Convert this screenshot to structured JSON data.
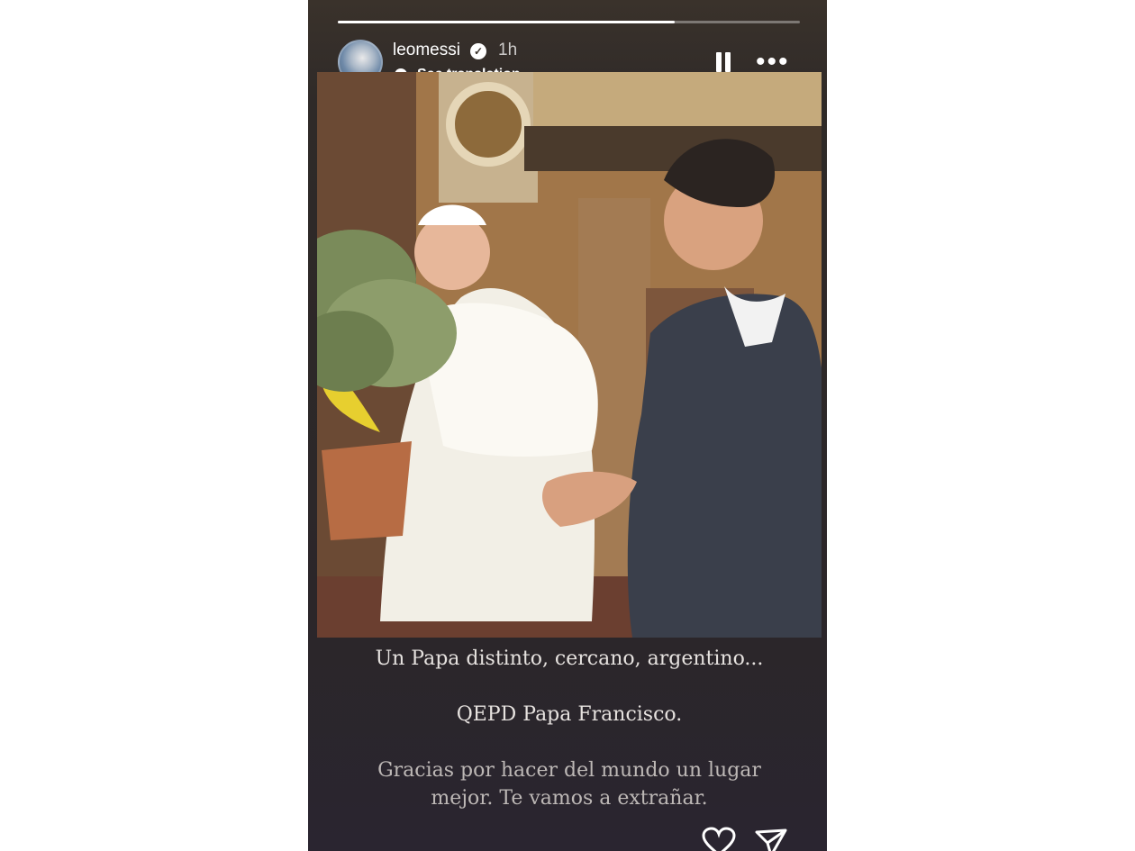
{
  "story": {
    "username": "leomessi",
    "time_ago": "1h",
    "see_translation": "See translation",
    "progress": 0.73,
    "caption_lines": [
      "Un Papa distinto, cercano, argentino...",
      "QEPD Papa Francisco.",
      "Gracias por hacer del mundo un lugar mejor. Te vamos a extrañar."
    ]
  },
  "icons": {
    "verified": "verified-badge-icon",
    "translate": "speech-bubble-icon",
    "pause": "pause-icon",
    "more": "more-dots-icon",
    "like": "heart-icon",
    "share": "send-icon"
  }
}
